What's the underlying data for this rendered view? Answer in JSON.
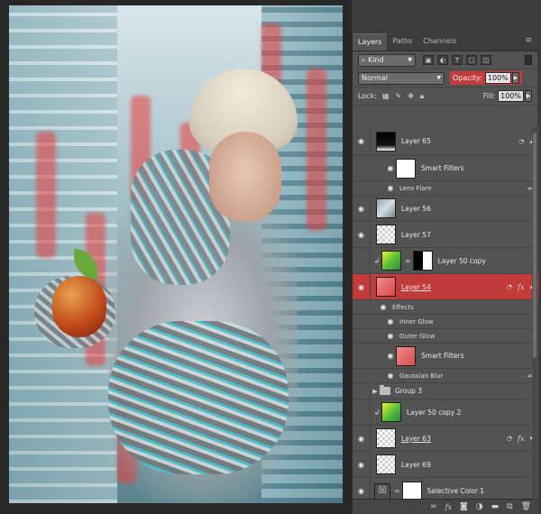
{
  "panel": {
    "tabs": [
      {
        "label": "Layers",
        "active": true
      },
      {
        "label": "Paths",
        "active": false
      },
      {
        "label": "Channels",
        "active": false
      }
    ],
    "filter": {
      "kind_label": "Kind"
    },
    "blend_mode": "Normal",
    "opacity_label": "Opacity:",
    "opacity_value": "100%",
    "lock_label": "Lock:",
    "fill_label": "Fill:",
    "fill_value": "100%"
  },
  "layers": [
    {
      "name": "Layer 65"
    },
    {
      "name": "Smart Filters"
    },
    {
      "name": "Lens Flare"
    },
    {
      "name": "Layer 56"
    },
    {
      "name": "Layer 57"
    },
    {
      "name": "Layer 50 copy"
    },
    {
      "name": "Layer 54"
    },
    {
      "name": "Effects"
    },
    {
      "name": "Inner Glow"
    },
    {
      "name": "Outer Glow"
    },
    {
      "name": "Smart Filters"
    },
    {
      "name": "Gaussian Blur"
    },
    {
      "name": "Group 3"
    },
    {
      "name": "Layer 50 copy 2"
    },
    {
      "name": "Layer 63"
    },
    {
      "name": "Layer 69"
    },
    {
      "name": "Selective Color 1"
    }
  ],
  "colors": {
    "panel_bg": "#535353",
    "selected_layer": "#c23b3b",
    "opacity_highlight": "#c53a3a"
  }
}
